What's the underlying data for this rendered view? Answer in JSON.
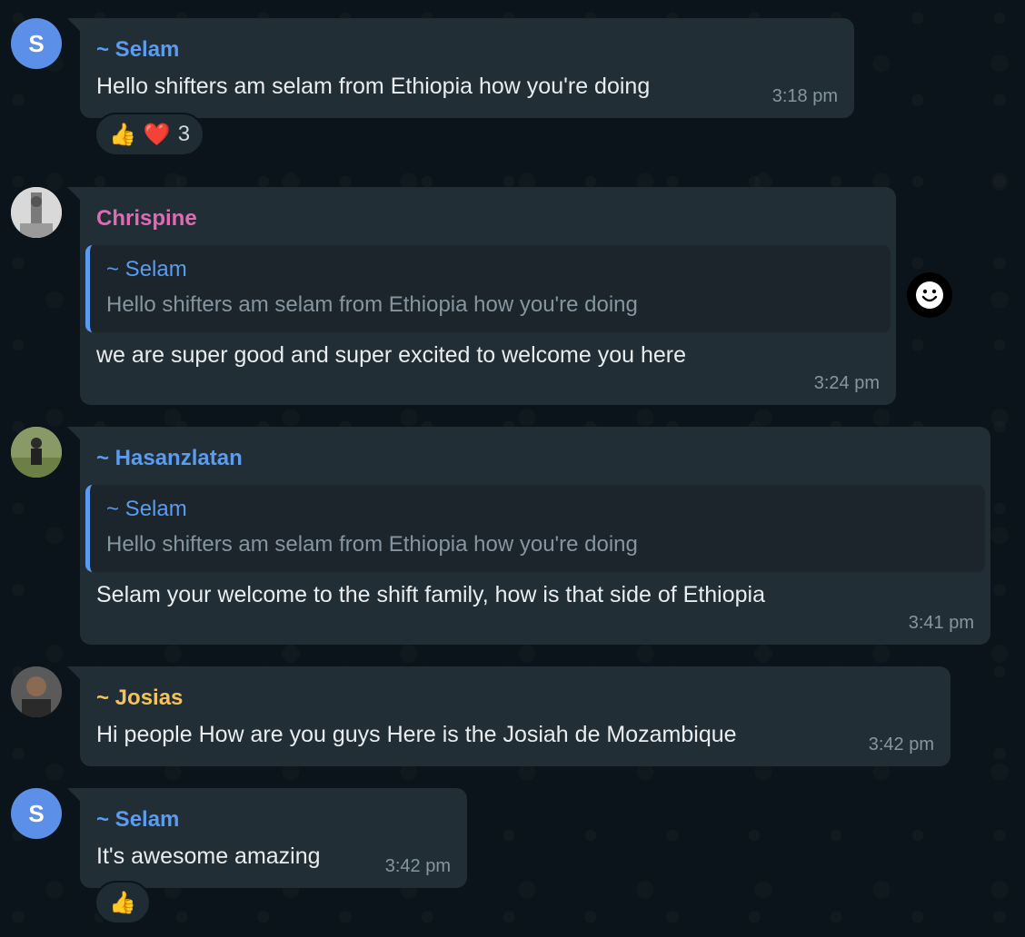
{
  "messages": [
    {
      "sender": "~ Selam",
      "sender_color": "#5b9bf0",
      "avatar_initial": "S",
      "text": "Hello shifters am selam from Ethiopia how you're doing",
      "time": "3:18 pm",
      "reactions": {
        "emojis": [
          "👍",
          "❤️"
        ],
        "count": "3"
      }
    },
    {
      "sender": "Chrispine",
      "sender_color": "#e26ab5",
      "quote": {
        "sender": "~ Selam",
        "text": "Hello shifters am selam from Ethiopia how you're doing"
      },
      "text": "we are super good and super excited to welcome you here",
      "time": "3:24 pm"
    },
    {
      "sender": "~ Hasanzlatan",
      "sender_color": "#5b9bf0",
      "quote": {
        "sender": "~ Selam",
        "text": "Hello shifters am selam from Ethiopia how you're doing"
      },
      "text": "Selam your welcome to the shift family, how is that side of Ethiopia",
      "time": "3:41 pm"
    },
    {
      "sender": "~ Josias",
      "sender_color": "#f5c35b",
      "text": "Hi people How are you guys Here is the Josiah de Mozambique",
      "time": "3:42 pm"
    },
    {
      "sender": "~ Selam",
      "sender_color": "#5b9bf0",
      "avatar_initial": "S",
      "text": "It's awesome amazing",
      "time": "3:42 pm",
      "reactions": {
        "emojis": [
          "👍"
        ]
      }
    }
  ],
  "icons": {
    "emoji_reaction_button": "smiley-icon"
  }
}
